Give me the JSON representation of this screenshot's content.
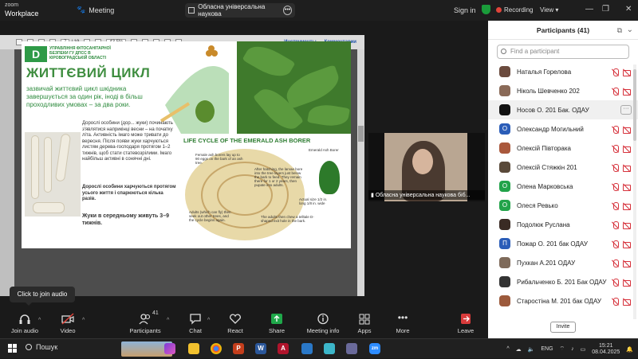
{
  "app": {
    "logo_line1": "zoom",
    "logo_line2": "Workplace",
    "meeting_label": "Meeting",
    "window_title": "Обласна універсальна наукова",
    "sign_in": "Sign in",
    "recording": "Recording",
    "view": "View"
  },
  "pdf": {
    "page_current": "7",
    "page_total": "/ 19",
    "zoom": "43,5%",
    "tools_link": "Инструменты",
    "comments_link": "Комментарии"
  },
  "slide": {
    "org": "УПРАВЛІННЯ ФІТОСАНІТАРНОЇ БЕЗПЕКИ ГУ ДПСС В КІРОВОГРАДСЬКІЙ ОБЛАСТІ",
    "heading": "ЖИТТЄВИЙ ЦИКЛ",
    "intro": "зазвичай життєвий цикл шкідника завершується за один рік, іноді в більш проходливих умовах  – за два роки.",
    "para1": "Дорослі особини (дор... жуки) починають з'являтися наприкінці весни – на початку літа. Активність імаго може тривати до вересня. Після появи жуки харчуються листям дерева-господаря протягом 1–2 тижнів, щоб стати статевозрілими. Імаго найбільш активні в сонячні дні.",
    "para2": "Дорослі особини харчуються протягом усього життя і спарюються кілька разів.",
    "para3": "Жуки в середньому живуть 3–9 тижнів.",
    "lc_title": "LIFE CYCLE OF THE EMERALD ASH BORER",
    "lc_note1": "Female ash borers lay up to 90 eggs on the bark of an ash tree.",
    "lc_note2": "After hatching, the larvae bore into the tree layers just below the bark to feed. They remain there for 1 or 2 years, then pupate into adults.",
    "lc_note3": "Adults (which can fly) then seek out other trees, and the cycle begins again.",
    "lc_note4": "The adults then chew a telltale D-shaped exit hole in the bark.",
    "beetle_label": "Emerald Ash Borer",
    "actual_size": "Actual size 1/2 in. long 1/8 in. wide"
  },
  "camera": {
    "label": "Обласна універсальна наукова біб..."
  },
  "participants": {
    "title": "Participants (41)",
    "search_placeholder": "Find a participant",
    "invite": "Invite",
    "list": [
      {
        "name": "Наталья Горелова",
        "initial": "",
        "color": "#6b4b3e"
      },
      {
        "name": "Ніколь Шевченко 202",
        "initial": "",
        "color": "#8a6a58"
      },
      {
        "name": "Носов О. 201 Бак. ОДАУ",
        "initial": "",
        "color": "#111111"
      },
      {
        "name": "Олександр Могильний",
        "initial": "О",
        "color": "#2b5db8"
      },
      {
        "name": "Олексій Півторака",
        "initial": "",
        "color": "#a9583c"
      },
      {
        "name": "Олексій Стяжкін 201",
        "initial": "",
        "color": "#5a4a3a"
      },
      {
        "name": "Олена Марковська",
        "initial": "О",
        "color": "#22a34a"
      },
      {
        "name": "Олеся Ревько",
        "initial": "О",
        "color": "#22a34a"
      },
      {
        "name": "Подолюк Руслана",
        "initial": "",
        "color": "#3a2b24"
      },
      {
        "name": "Пожар О. 201 бак ОДАУ",
        "initial": "П",
        "color": "#2b5db8"
      },
      {
        "name": "Пухкан А.201 ОДАУ",
        "initial": "",
        "color": "#7e6a5a"
      },
      {
        "name": "Рибальченко Б. 201 Бак ОДАУ",
        "initial": "",
        "color": "#333333"
      },
      {
        "name": "Старостіна М. 201 бак ОДАУ",
        "initial": "",
        "color": "#9c5a3c"
      }
    ]
  },
  "tooltip": "Click to join audio",
  "controls": {
    "join_audio": "Join audio",
    "video": "Video",
    "participants": "Participants",
    "participants_count": "41",
    "chat": "Chat",
    "react": "React",
    "share": "Share",
    "meeting_info": "Meeting info",
    "apps": "Apps",
    "more": "More",
    "leave": "Leave"
  },
  "taskbar": {
    "search": "Пошук",
    "lang": "ENG",
    "time": "15:21",
    "date": "08.04.2025"
  }
}
